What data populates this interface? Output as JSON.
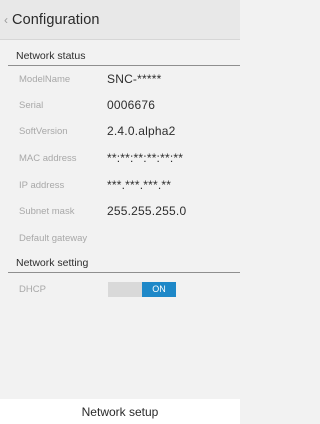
{
  "header": {
    "title": "Configuration",
    "back_icon": "‹"
  },
  "network_status": {
    "title": "Network status",
    "rows": [
      {
        "label": "ModelName",
        "value": "SNC-*****"
      },
      {
        "label": "Serial",
        "value": "0006676"
      },
      {
        "label": "SoftVersion",
        "value": "2.4.0.alpha2"
      },
      {
        "label": "MAC address",
        "value": "**:**:**:**:**:**"
      },
      {
        "label": "IP address",
        "value": "***.***.***.**"
      },
      {
        "label": "Subnet mask",
        "value": "255.255.255.0"
      },
      {
        "label": "Default gateway",
        "value": ""
      }
    ]
  },
  "network_setting": {
    "title": "Network setting",
    "dhcp": {
      "label": "DHCP",
      "state": "ON"
    }
  },
  "footer": {
    "label": "Network setup"
  }
}
